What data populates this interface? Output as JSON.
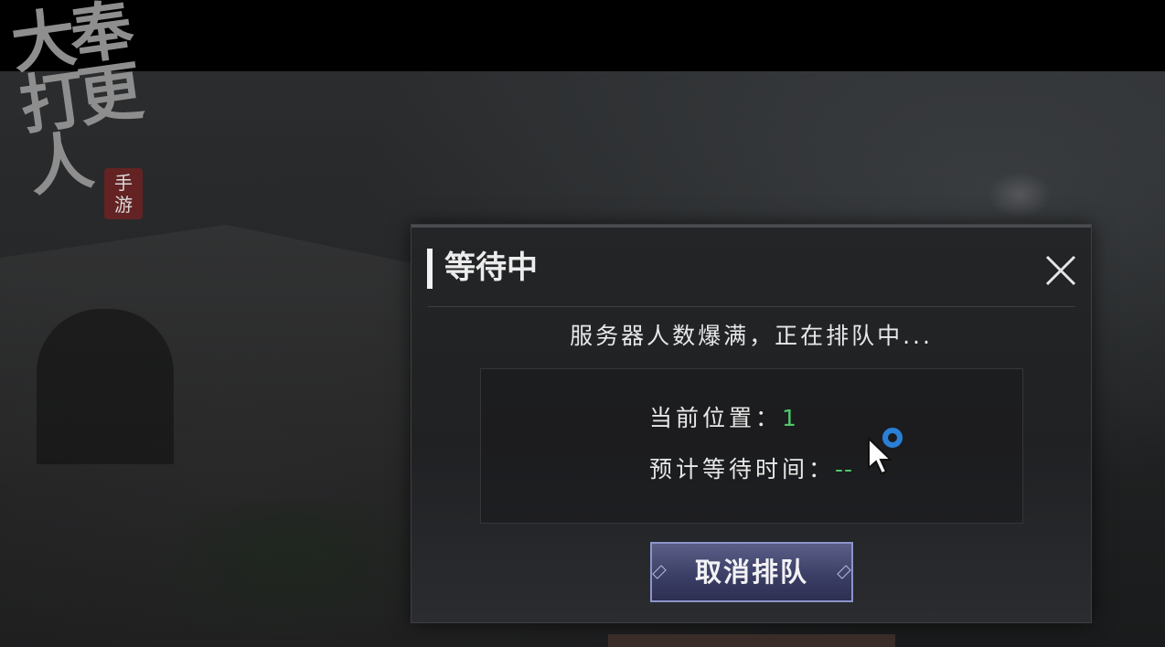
{
  "logo": {
    "main_text": "大奉打更人",
    "sub_text": "手游"
  },
  "dialog": {
    "title": "等待中",
    "message": "服务器人数爆满，正在排队中...",
    "position_label": "当前位置：",
    "position_value": "1",
    "wait_label": "预计等待时间：",
    "wait_value": "--",
    "cancel_label": "取消排队"
  },
  "colors": {
    "value_green": "#4fc86e",
    "button_purple": "#3c3f66",
    "cursor_ring_blue": "#2a7fd6"
  },
  "icons": {
    "close": "close-icon",
    "cursor": "mouse-cursor-icon",
    "loading": "loading-ring-icon"
  }
}
